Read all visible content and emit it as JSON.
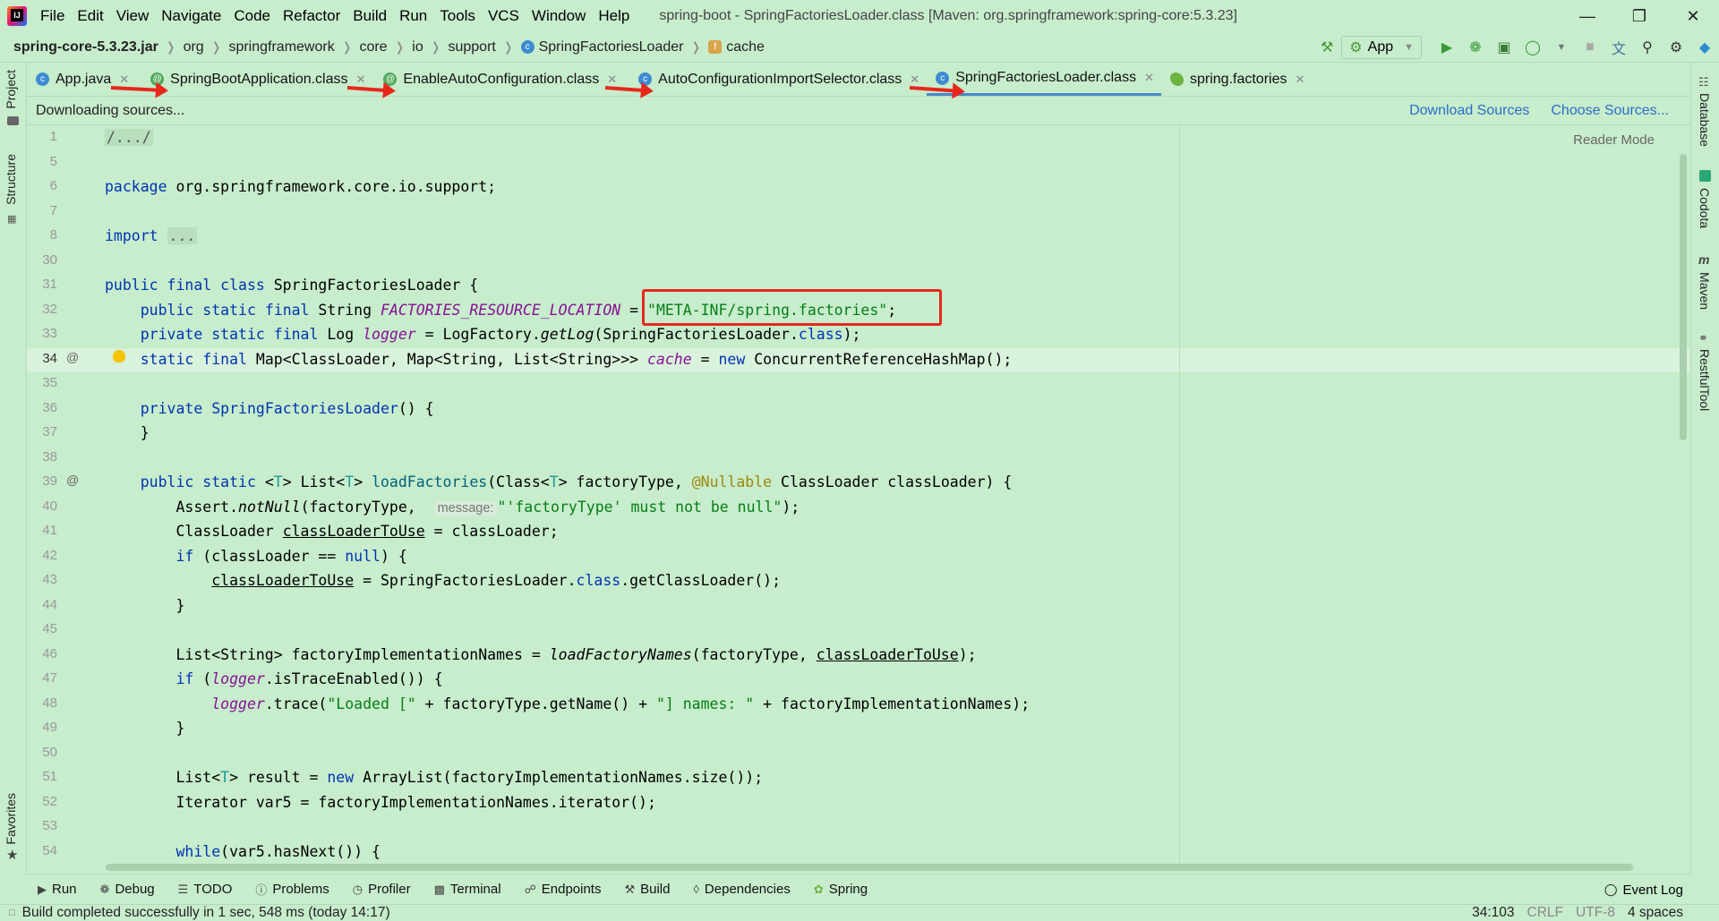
{
  "window": {
    "title": "spring-boot - SpringFactoriesLoader.class [Maven: org.springframework:spring-core:5.3.23]",
    "menu": [
      "File",
      "Edit",
      "View",
      "Navigate",
      "Code",
      "Refactor",
      "Build",
      "Run",
      "Tools",
      "VCS",
      "Window",
      "Help"
    ],
    "logo_text": "IJ"
  },
  "breadcrumbs": [
    "spring-core-5.3.23.jar",
    "org",
    "springframework",
    "core",
    "io",
    "support",
    "SpringFactoriesLoader",
    "cache"
  ],
  "run_config": {
    "label": "App"
  },
  "tabs": [
    {
      "label": "App.java",
      "icon": "class-icon"
    },
    {
      "label": "SpringBootApplication.class",
      "icon": "annotation-icon"
    },
    {
      "label": "EnableAutoConfiguration.class",
      "icon": "annotation-icon"
    },
    {
      "label": "AutoConfigurationImportSelector.class",
      "icon": "class-icon"
    },
    {
      "label": "SpringFactoriesLoader.class",
      "icon": "class-icon",
      "active": true
    },
    {
      "label": "spring.factories",
      "icon": "spring-icon"
    }
  ],
  "infobar": {
    "text": "Downloading sources...",
    "download_sources": "Download Sources",
    "choose_sources": "Choose Sources..."
  },
  "editor": {
    "reader_mode": "Reader Mode",
    "line_numbers": [
      "1",
      "5",
      "6",
      "7",
      "8",
      "30",
      "31",
      "32",
      "33",
      "34",
      "35",
      "36",
      "37",
      "38",
      "39",
      "40",
      "41",
      "42",
      "43",
      "44",
      "45",
      "46",
      "47",
      "48",
      "49",
      "50",
      "51",
      "52",
      "53",
      "54"
    ],
    "hint_message": "message:"
  },
  "left_tabs": {
    "project": "Project",
    "structure": "Structure",
    "favorites": "Favorites"
  },
  "right_tabs": {
    "database": "Database",
    "codota": "Codota",
    "maven": "Maven",
    "restful": "RestfulTool"
  },
  "bottom_tools": [
    "Run",
    "Debug",
    "TODO",
    "Problems",
    "Profiler",
    "Terminal",
    "Endpoints",
    "Build",
    "Dependencies",
    "Spring"
  ],
  "event_log": "Event Log",
  "status": {
    "message": "Build completed successfully in 1 sec, 548 ms (today 14:17)",
    "position": "34:103",
    "line_sep": "CRLF",
    "encoding": "UTF-8",
    "indent": "4 spaces"
  },
  "colors": {
    "accent": "#4a88c7",
    "annotation_box": "#e8271c",
    "background": "#c7edcc"
  }
}
